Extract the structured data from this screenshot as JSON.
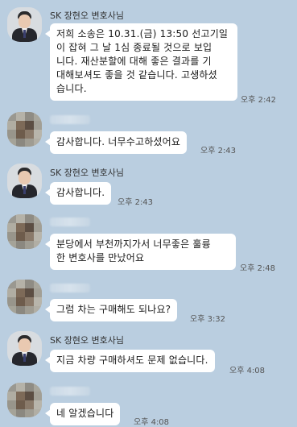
{
  "lawyer_name": "SK 장현오 변호사님",
  "messages": [
    {
      "lines": [
        "저희 소송은 10.31.(금) 13:50 선고기일",
        "이 잡혀 그 날 1심 종료될 것으로 보입",
        "니다. 재산분할에 대해 좋은 결과를 기",
        "대해보셔도 좋을 것 같습니다. 고생하셨",
        "습니다."
      ],
      "time": "오후 2:42"
    },
    {
      "text": "감사합니다. 너무수고하셨어요",
      "time": "오후 2:43"
    },
    {
      "text": "감사합니다.",
      "time": "오후 2:43"
    },
    {
      "lines": [
        "분당에서 부천까지가서 너무좋은 훌륭",
        "한 변호사를 만났어요"
      ],
      "time": "오후 2:48"
    },
    {
      "text": "그럼 차는 구매해도 되나요?",
      "time": "오후 3:32"
    },
    {
      "text": "지금 차량 구매하셔도 문제 없습니다.",
      "time": "오후 4:08"
    },
    {
      "text": "네 알겠습니다",
      "time": "오후 4:08"
    }
  ],
  "colors": {
    "background": "#bacee0",
    "bubble": "#ffffff"
  },
  "icons": {
    "lawyer_avatar": "lawyer-avatar",
    "client_avatar": "blurred-avatar"
  }
}
